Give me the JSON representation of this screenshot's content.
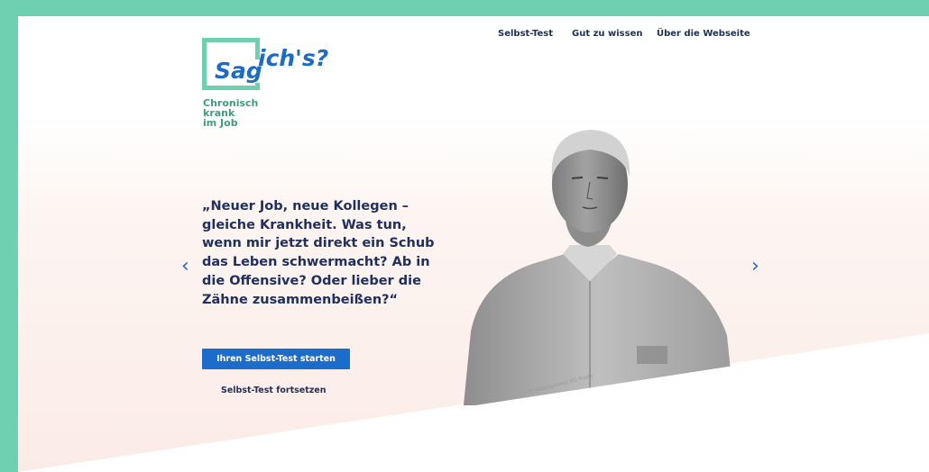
{
  "logo": {
    "word1": "Sag",
    "word2": "ich's?",
    "subtitle": [
      "Chronisch",
      "krank",
      "im Job"
    ]
  },
  "nav": {
    "items": [
      {
        "label": "Selbst-Test"
      },
      {
        "label": "Gut zu wissen"
      },
      {
        "label": "Über die Webseite"
      }
    ]
  },
  "hero": {
    "quote": "„Neuer Job, neue Kollegen – gleiche Krankheit. Was tun, wenn mir jetzt direkt ein Schub das Leben schwermacht? Ab in die Offensive? Oder lieber die Zähne zusammenbeißen?“",
    "prev_icon": "‹",
    "next_icon": "›",
    "start_button": "Ihren Selbst-Test starten",
    "continue_link": "Selbst-Test fortsetzen",
    "photo_credit": "© iStockphoto/ FG Trade"
  },
  "colors": {
    "frame": "#6fcfb1",
    "accent_blue": "#1c6ccc",
    "text_navy": "#1f3060",
    "logo_green": "#3f9c80",
    "hero_tint": "#fcefeb"
  },
  "icons": {
    "prev": "chevron-left-icon",
    "next": "chevron-right-icon"
  }
}
